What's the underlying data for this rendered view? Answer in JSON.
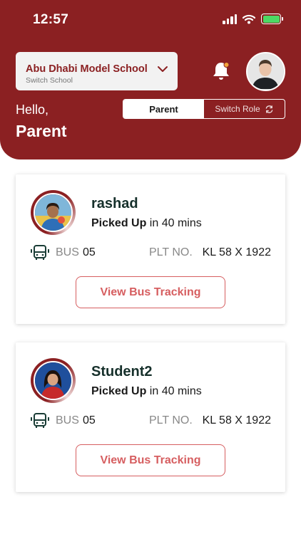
{
  "status_bar": {
    "time": "12:57"
  },
  "header": {
    "school_name": "Abu Dhabi Model School",
    "school_sub": "Switch School",
    "greeting": "Hello,",
    "role_name": "Parent",
    "role_toggle": {
      "active": "Parent",
      "switch_label": "Switch Role"
    }
  },
  "colors": {
    "brand": "#8b2022",
    "accent": "#d65e60",
    "battery": "#4cd964"
  },
  "students": [
    {
      "name": "rashad",
      "status_bold": "Picked Up",
      "status_rest": " in 40 mins",
      "bus_label": "BUS",
      "bus_number": "05",
      "plate_label": "PLT NO.",
      "plate_number": "KL 58 X 1922",
      "button_label": "View Bus Tracking"
    },
    {
      "name": "Student2",
      "status_bold": "Picked Up",
      "status_rest": " in 40 mins",
      "bus_label": "BUS",
      "bus_number": "05",
      "plate_label": "PLT NO.",
      "plate_number": "KL 58 X 1922",
      "button_label": "View Bus Tracking"
    }
  ],
  "icons": [
    "signal-icon",
    "wifi-icon",
    "battery-icon",
    "chevron-down-icon",
    "bell-icon",
    "refresh-icon",
    "bus-icon"
  ]
}
